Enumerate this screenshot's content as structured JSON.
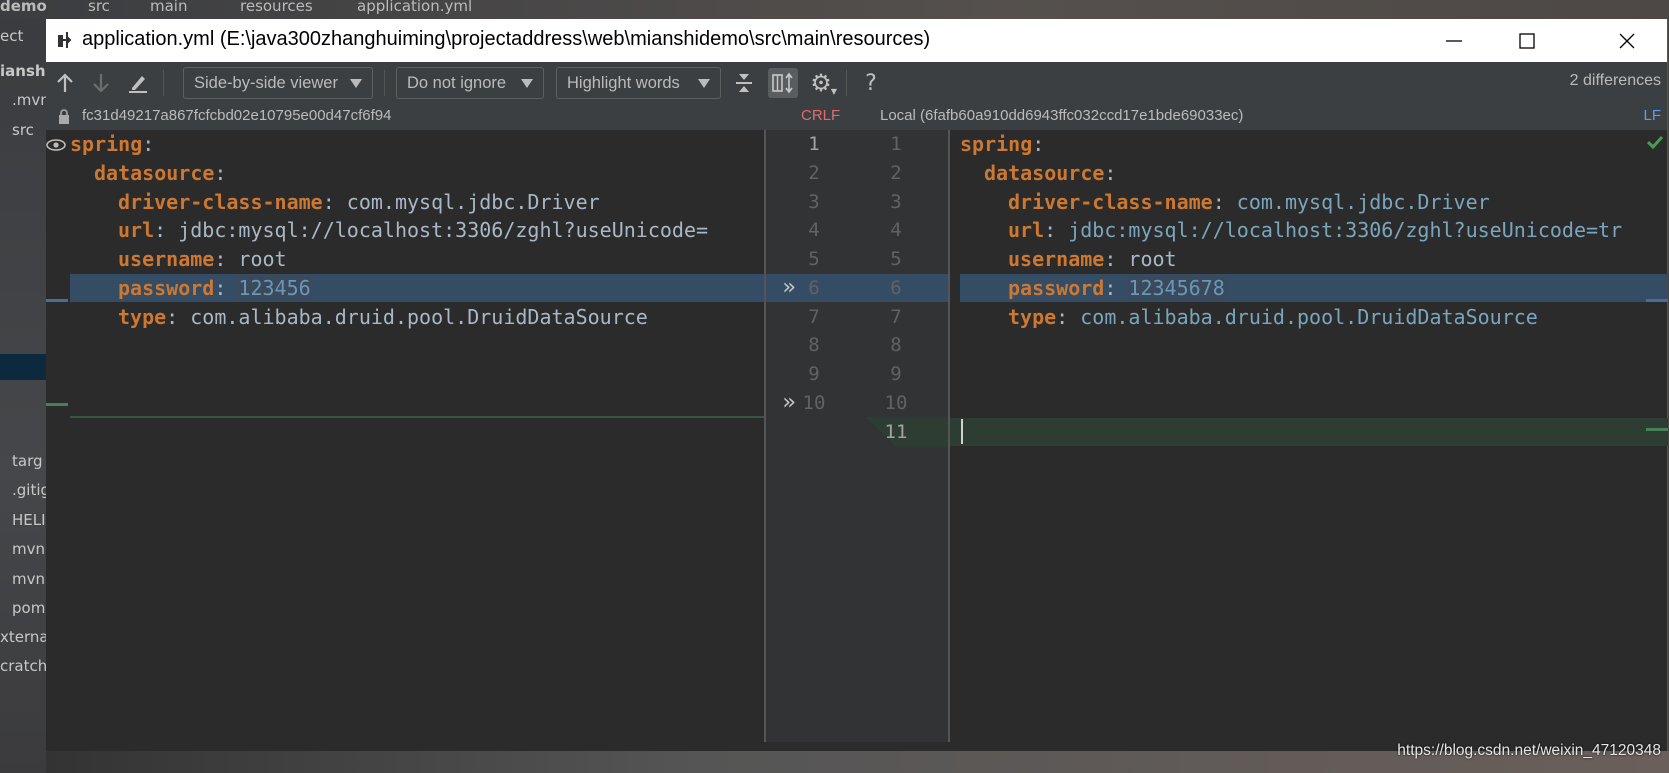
{
  "background": {
    "breadcrumb": [
      "demo",
      "src",
      "main",
      "resources",
      "application.yml"
    ],
    "sidebar_items": [
      "ect",
      "ianshi",
      ".mvn",
      "src",
      "targ",
      ".gitig",
      "HELI",
      "mvn",
      "mvn",
      "pom",
      "xternal",
      "cratche"
    ]
  },
  "window": {
    "title": "application.yml (E:\\java300zhanghuiming\\projectaddress\\web\\mianshidemo\\src\\main\\resources)"
  },
  "toolbar": {
    "prev_diff_icon": "arrow-up-icon",
    "next_diff_icon": "arrow-down-icon",
    "edit_icon": "pencil-icon",
    "viewer_select": "Side-by-side viewer",
    "ignore_select": "Do not ignore",
    "highlight_select": "Highlight words",
    "help": "?",
    "differences": "2 differences"
  },
  "left": {
    "revision": "fc31d49217a867fcfcbd02e10795e00d47cf6f94",
    "line_separator": "CRLF",
    "lines": [
      {
        "key": "spring",
        "indent": 0,
        "value": ""
      },
      {
        "key": "datasource",
        "indent": 1,
        "value": ""
      },
      {
        "key": "driver-class-name",
        "indent": 2,
        "value": "com.mysql.jdbc.Driver"
      },
      {
        "key": "url",
        "indent": 2,
        "value": "jdbc:mysql://localhost:3306/zghl?useUnicode="
      },
      {
        "key": "username",
        "indent": 2,
        "value": "root"
      },
      {
        "key": "password",
        "indent": 2,
        "value": "123456"
      },
      {
        "key": "type",
        "indent": 2,
        "value": "com.alibaba.druid.pool.DruidDataSource"
      }
    ],
    "line_numbers": [
      "1",
      "2",
      "3",
      "4",
      "5",
      "6",
      "7",
      "8",
      "9",
      "10"
    ]
  },
  "right": {
    "revision": "Local (6fafb60a910dd6943ffc032ccd17e1bde69033ec)",
    "line_separator": "LF",
    "lines": [
      {
        "key": "spring",
        "indent": 0,
        "value": ""
      },
      {
        "key": "datasource",
        "indent": 1,
        "value": ""
      },
      {
        "key": "driver-class-name",
        "indent": 2,
        "value": "com.mysql.jdbc.Driver"
      },
      {
        "key": "url",
        "indent": 2,
        "value": "jdbc:mysql://localhost:3306/zghl?useUnicode=tr"
      },
      {
        "key": "username",
        "indent": 2,
        "value": "root"
      },
      {
        "key": "password",
        "indent": 2,
        "value": "12345678"
      },
      {
        "key": "type",
        "indent": 2,
        "value": "com.alibaba.druid.pool.DruidDataSource"
      }
    ],
    "line_numbers": [
      "1",
      "2",
      "3",
      "4",
      "5",
      "6",
      "7",
      "8",
      "9",
      "10",
      "11"
    ]
  },
  "changes": {
    "modified_line": 6,
    "inserted_line_right": 11,
    "apply_arrows_left_lines": [
      6,
      10
    ]
  },
  "colors": {
    "key": "#cc7832",
    "modified": "#344c64",
    "inserted": "#2d3d33",
    "crlf": "#e06c6c",
    "lf": "#589df6",
    "ok": "#499c54"
  },
  "watermark": "https://blog.csdn.net/weixin_47120348"
}
